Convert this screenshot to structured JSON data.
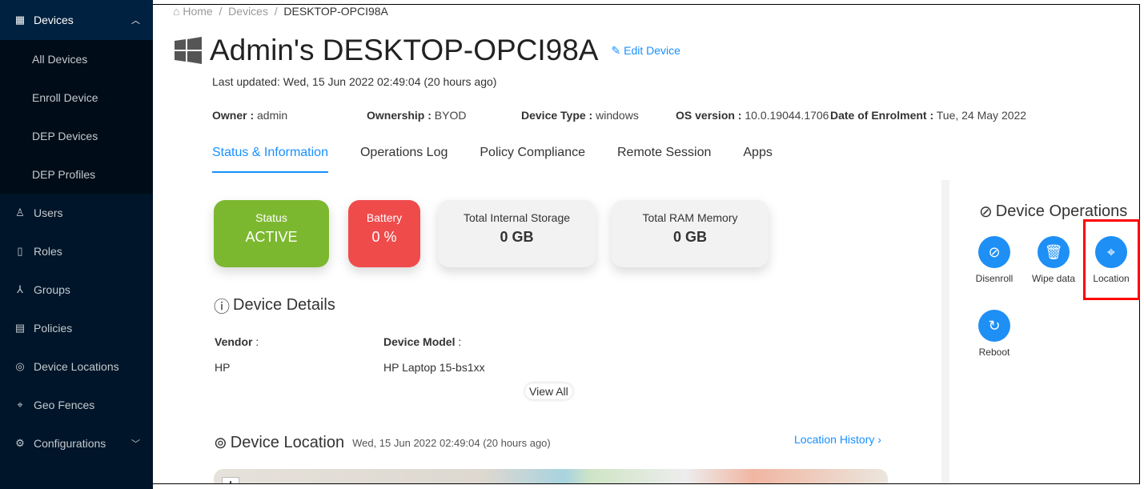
{
  "sidebar": {
    "items": [
      {
        "label": "Devices",
        "icon": "grid-icon"
      },
      {
        "label": "All Devices"
      },
      {
        "label": "Enroll Device"
      },
      {
        "label": "DEP Devices"
      },
      {
        "label": "DEP Profiles"
      },
      {
        "label": "Users",
        "icon": "user-icon"
      },
      {
        "label": "Roles",
        "icon": "book-icon"
      },
      {
        "label": "Groups",
        "icon": "cluster-icon"
      },
      {
        "label": "Policies",
        "icon": "policy-icon"
      },
      {
        "label": "Device Locations",
        "icon": "pin-icon"
      },
      {
        "label": "Geo Fences",
        "icon": "geofence-icon"
      },
      {
        "label": "Configurations",
        "icon": "gear-icon"
      }
    ]
  },
  "breadcrumb": [
    "Home",
    "Devices",
    "DESKTOP-OPCI98A"
  ],
  "header": {
    "title": "Admin's DESKTOP-OPCI98A",
    "edit": "Edit Device",
    "updated": "Last updated: Wed, 15 Jun 2022 02:49:04 (20 hours ago)"
  },
  "meta": [
    {
      "k": "Owner :",
      "v": " admin"
    },
    {
      "k": "Ownership :",
      "v": " BYOD"
    },
    {
      "k": "Device Type :",
      "v": " windows"
    },
    {
      "k": "OS version :",
      "v": " 10.0.19044.1706"
    },
    {
      "k": "Date of Enrolment :",
      "v": " Tue, 24 May 2022"
    }
  ],
  "tabs": [
    "Status & Information",
    "Operations Log",
    "Policy Compliance",
    "Remote Session",
    "Apps"
  ],
  "cards": {
    "status_label": "Status",
    "status": "ACTIVE",
    "battery_label": "Battery",
    "battery": "0 %",
    "storage_label": "Total Internal Storage",
    "storage": "0 GB",
    "ram_label": "Total RAM Memory",
    "ram": "0 GB"
  },
  "details": {
    "title": "Device Details",
    "vendor_label": "Vendor",
    "vendor": "HP",
    "model_label": "Device Model",
    "model": "HP Laptop 15-bs1xx",
    "view_all": "View All"
  },
  "location": {
    "title": "Device Location",
    "time": "Wed, 15 Jun 2022 02:49:04 (20 hours ago)",
    "history": "Location History"
  },
  "operations": {
    "title": "Device Operations",
    "items": [
      "Disenroll",
      "Wipe data",
      "Location",
      "Reboot"
    ]
  },
  "colors": {
    "accent": "#1890ff",
    "status": "#7cb82f",
    "battery": "#ef4b4b",
    "sidebar": "#001529",
    "highlight": "#ff0000"
  }
}
